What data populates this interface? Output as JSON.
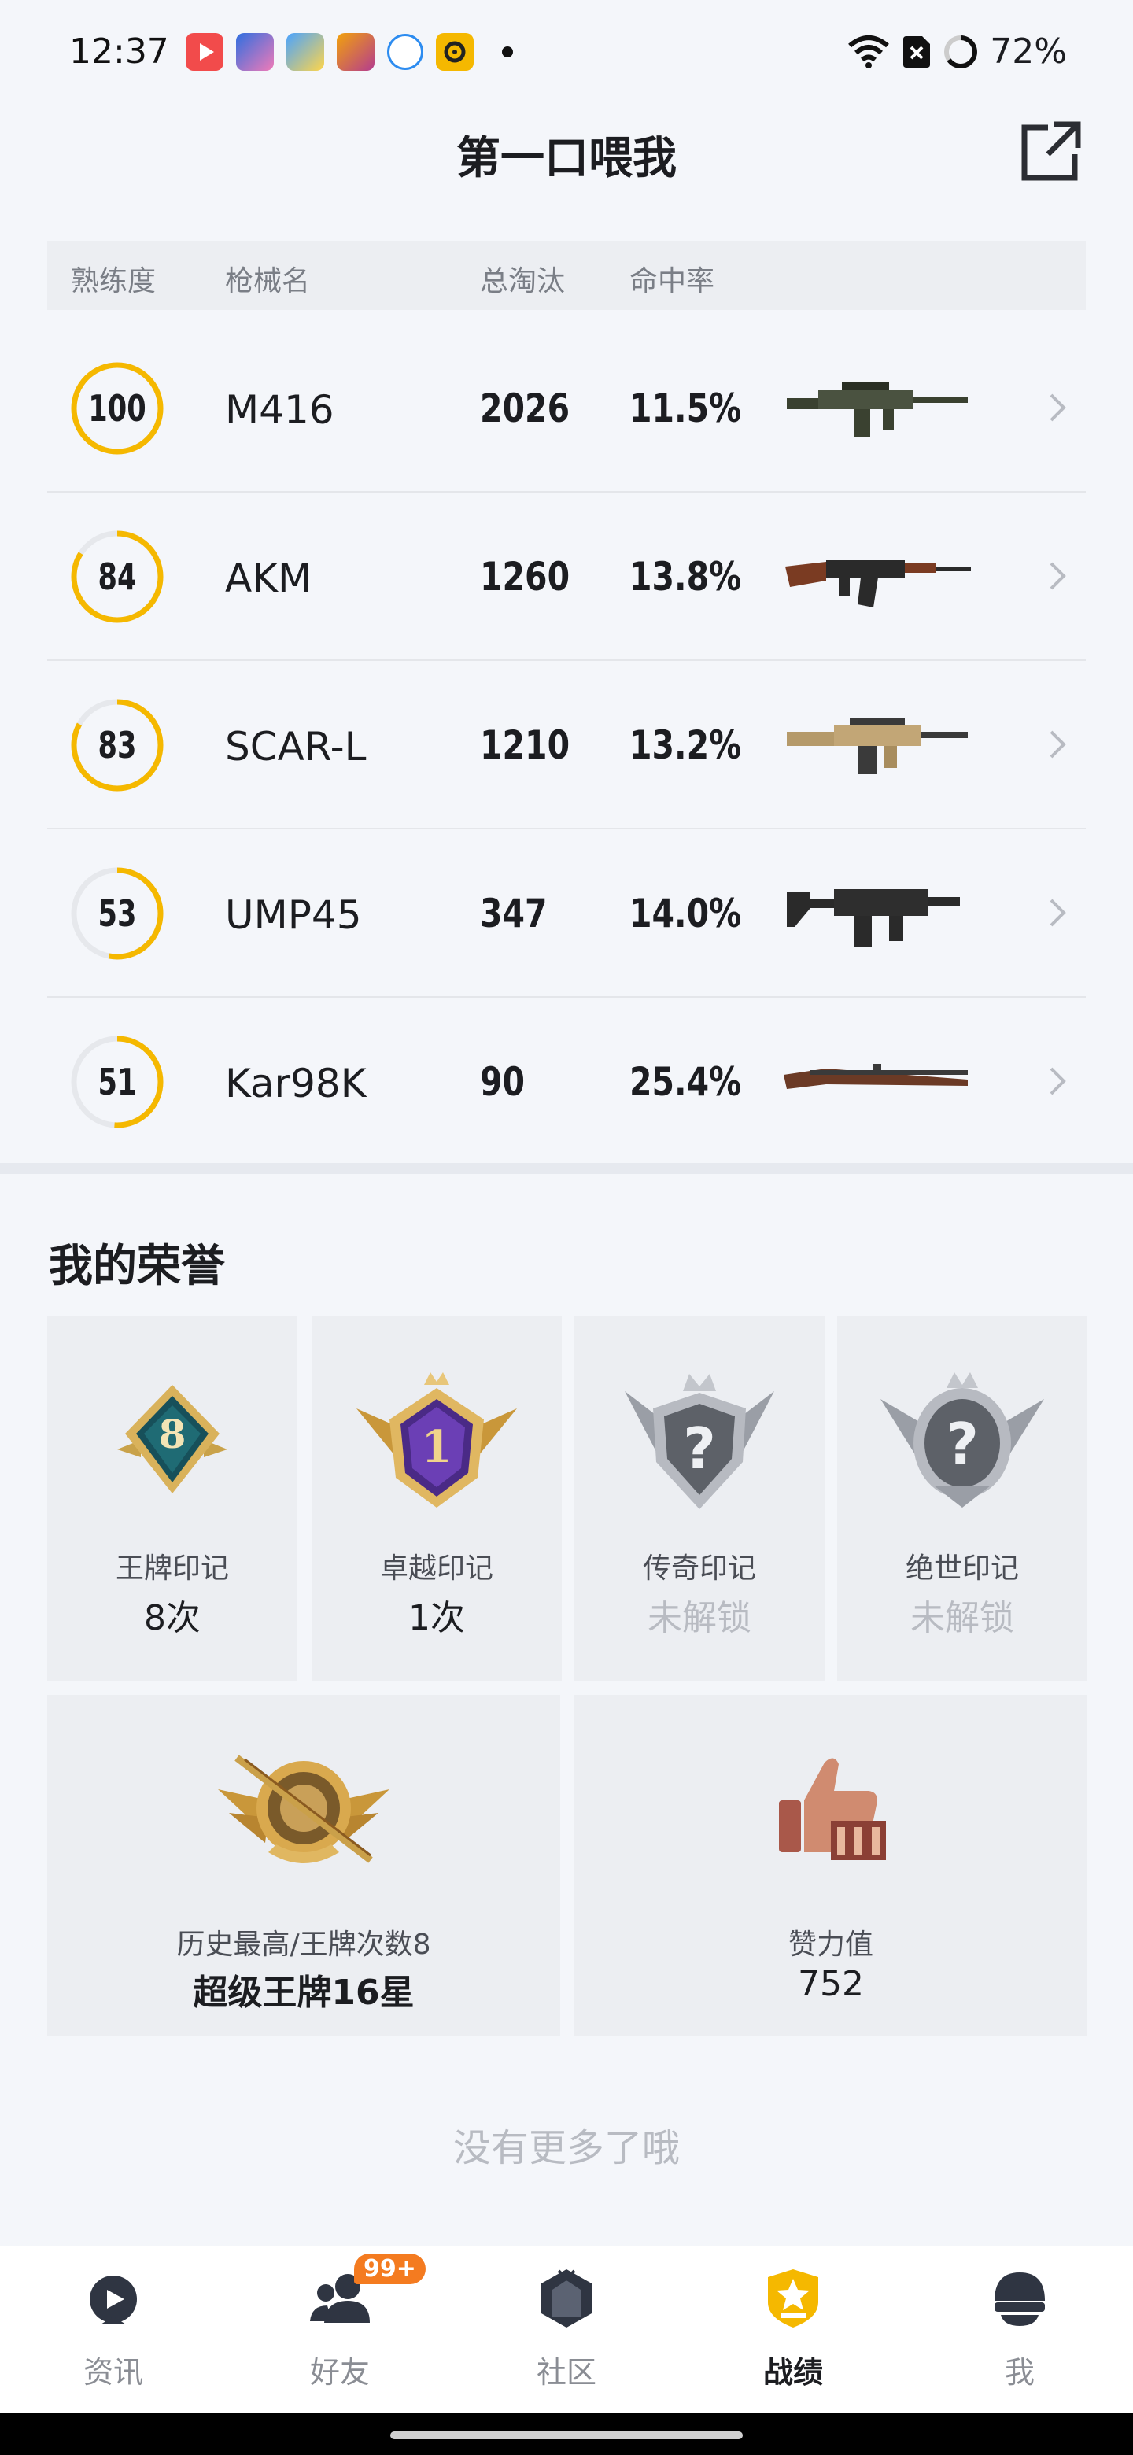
{
  "status_bar": {
    "time": "12:37",
    "battery": "72%"
  },
  "header": {
    "title": "第一口喂我"
  },
  "table": {
    "columns": [
      "熟练度",
      "枪械名",
      "总淘汰",
      "命中率"
    ],
    "rows": [
      {
        "proficiency": "100",
        "progress": 1.0,
        "name": "M416",
        "kills": "2026",
        "hit_rate": "11.5%",
        "gun_icon": "assault-rifle-icon"
      },
      {
        "proficiency": "84",
        "progress": 0.84,
        "name": "AKM",
        "kills": "1260",
        "hit_rate": "13.8%",
        "gun_icon": "akm-rifle-icon"
      },
      {
        "proficiency": "83",
        "progress": 0.83,
        "name": "SCAR-L",
        "kills": "1210",
        "hit_rate": "13.2%",
        "gun_icon": "scar-rifle-icon"
      },
      {
        "proficiency": "53",
        "progress": 0.53,
        "name": "UMP45",
        "kills": "347",
        "hit_rate": "14.0%",
        "gun_icon": "smg-icon"
      },
      {
        "proficiency": "51",
        "progress": 0.51,
        "name": "Kar98K",
        "kills": "90",
        "hit_rate": "25.4%",
        "gun_icon": "bolt-rifle-icon"
      }
    ]
  },
  "honors": {
    "title": "我的荣誉",
    "marks": [
      {
        "label": "王牌印记",
        "value": "8次",
        "locked": false,
        "badge_text": "8"
      },
      {
        "label": "卓越印记",
        "value": "1次",
        "locked": false,
        "badge_text": "1"
      },
      {
        "label": "传奇印记",
        "value": "未解锁",
        "locked": true,
        "badge_text": "?"
      },
      {
        "label": "绝世印记",
        "value": "未解锁",
        "locked": true,
        "badge_text": "?"
      }
    ],
    "rank": {
      "label": "历史最高/王牌次数8",
      "value": "超级王牌16星"
    },
    "likes": {
      "label": "赞力值",
      "value": "752"
    }
  },
  "footer_text": "没有更多了哦",
  "tabs": [
    {
      "label": "资讯",
      "icon": "news-icon",
      "active": false
    },
    {
      "label": "好友",
      "icon": "friends-icon",
      "active": false,
      "badge": "99+"
    },
    {
      "label": "社区",
      "icon": "community-icon",
      "active": false
    },
    {
      "label": "战绩",
      "icon": "record-icon",
      "active": true
    },
    {
      "label": "我",
      "icon": "profile-icon",
      "active": false
    }
  ],
  "colors": {
    "accent": "#f5b800",
    "ring_track": "#e6e8ec",
    "badge": "#f47b20"
  }
}
